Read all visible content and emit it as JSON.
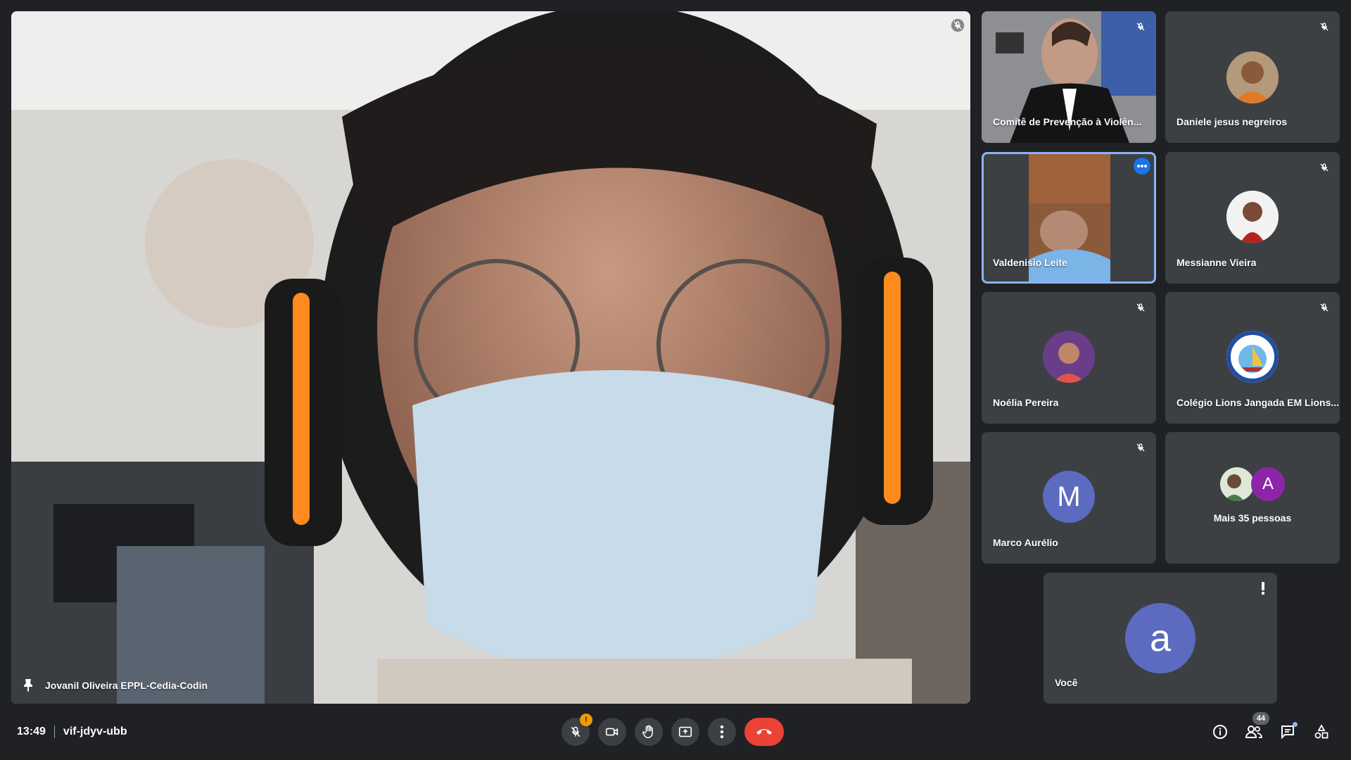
{
  "main_video": {
    "participant_name": "Jovanil Oliveira EPPL-Cedia-Codin"
  },
  "tiles": [
    {
      "name": "Comitê de Prevenção à Violên...",
      "muted": true
    },
    {
      "name": "Daniele jesus negreiros",
      "muted": true
    },
    {
      "name": "Valdenisio Leite",
      "muted": false,
      "active": true
    },
    {
      "name": "Messianne Vieira",
      "muted": true
    },
    {
      "name": "Noélia Pereira",
      "muted": true
    },
    {
      "name": "Colégio Lions Jangada EM Lions...",
      "muted": true
    },
    {
      "name": "Marco Aurélio",
      "muted": true,
      "avatar_letter": "M"
    },
    {
      "name": "Mais 35 pessoas",
      "avatar_letter": "A"
    },
    {
      "name": "Você",
      "avatar_letter": "a"
    }
  ],
  "bottom_bar": {
    "time": "13:49",
    "meeting_code": "vif-jdyv-ubb",
    "mic_warning_badge": "!",
    "people_count": "44"
  },
  "colors": {
    "background": "#202124",
    "tile": "#3c4043",
    "end_call": "#ea4335",
    "active_border": "#8ab4f8",
    "avatar_m": "#5c6bc0",
    "avatar_you": "#5c6bc0",
    "avatar_a": "#8e24aa",
    "warning": "#f29900"
  },
  "icons": [
    "mic-off-icon",
    "camera-icon",
    "raise-hand-icon",
    "present-icon",
    "more-vert-icon",
    "end-call-icon",
    "info-icon",
    "people-icon",
    "chat-icon",
    "activities-icon",
    "pin-icon"
  ]
}
